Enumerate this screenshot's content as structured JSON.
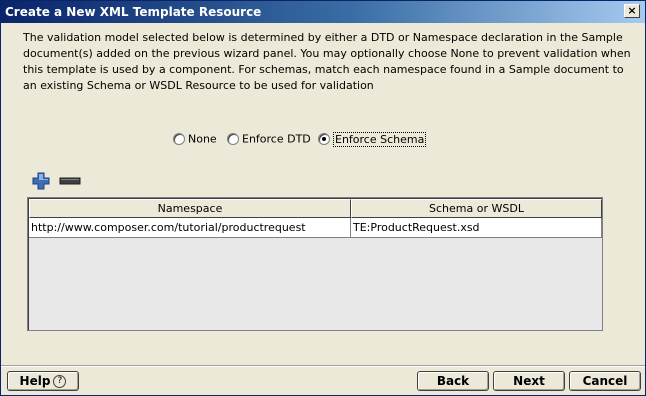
{
  "window": {
    "title": "Create a New XML Template Resource",
    "close_glyph": "×"
  },
  "description": "The validation model selected below is determined by either a DTD or Namespace declaration in the Sample document(s) added on the previous wizard panel.  You may optionally choose None to prevent validation when this template is used by a component.  For schemas, match each namespace found in a Sample document to an existing Schema or WSDL Resource to be used for validation",
  "validation": {
    "options": [
      {
        "label": "None",
        "checked": false
      },
      {
        "label": "Enforce DTD",
        "checked": false
      },
      {
        "label": "Enforce Schema",
        "checked": true
      }
    ]
  },
  "toolbar": {
    "add_icon": "plus-icon",
    "remove_icon": "minus-icon",
    "add_color": "#3B6FB6",
    "remove_color": "#404040"
  },
  "table": {
    "columns": [
      "Namespace",
      "Schema or WSDL"
    ],
    "rows": [
      [
        "http://www.composer.com/tutorial/productrequest",
        "TE:ProductRequest.xsd"
      ]
    ]
  },
  "buttons": {
    "help": "Help",
    "help_glyph": "?",
    "back": "Back",
    "next": "Next",
    "cancel": "Cancel"
  }
}
